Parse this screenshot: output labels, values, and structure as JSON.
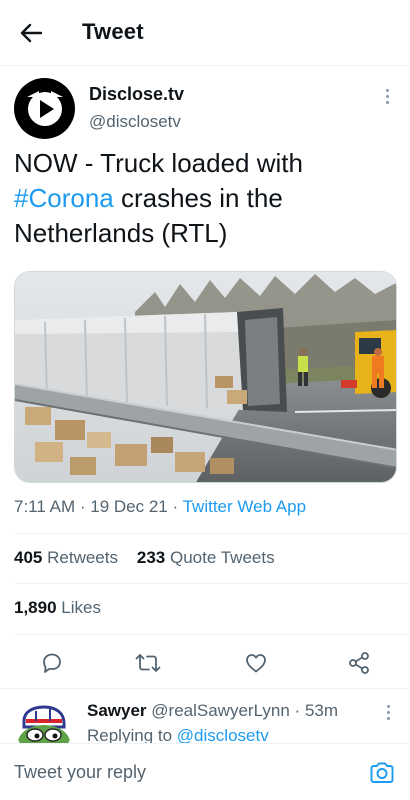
{
  "header": {
    "title": "Tweet",
    "back_icon": "arrow-left-icon"
  },
  "tweet": {
    "author_name": "Disclose.tv",
    "author_handle": "@disclosetv",
    "text_before": "NOW - Truck loaded with ",
    "hashtag": "#Corona",
    "text_after": " crashes in the Netherlands (RTL)",
    "time": "7:11 AM",
    "date": "19 Dec 21",
    "separator": "·",
    "source_app": "Twitter Web App"
  },
  "stats": {
    "retweets_count": "405",
    "retweets_label": "Retweets",
    "quotes_count": "233",
    "quotes_label": "Quote Tweets",
    "likes_count": "1,890",
    "likes_label": "Likes"
  },
  "reply": {
    "name": "Sawyer",
    "handle": "@realSawyerLynn",
    "separator": "·",
    "time": "53m",
    "replying_prefix": "Replying to",
    "replying_to": "@disclosetv"
  },
  "composer": {
    "placeholder": "Tweet your reply"
  },
  "colors": {
    "accent": "#1d9bf0",
    "text": "#0f1419",
    "muted": "#536471",
    "border": "#eff3f4"
  }
}
